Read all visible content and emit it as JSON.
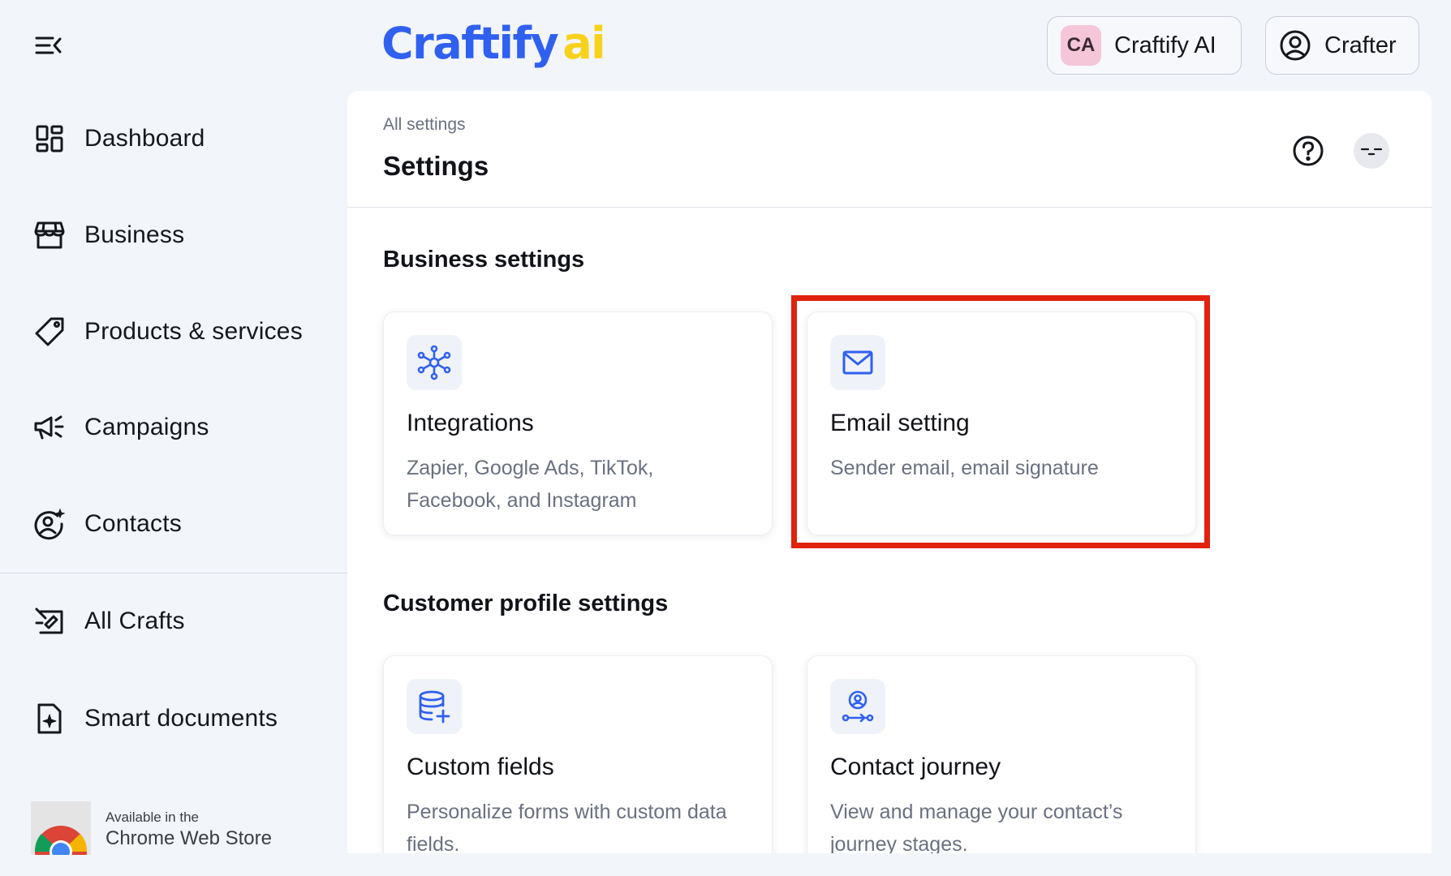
{
  "app": {
    "logo_part1": "Craftify",
    "logo_part2": "ai",
    "brand_color": "#3060f0",
    "brand_accent": "#f8d21a"
  },
  "sidebar": {
    "items": [
      {
        "label": "Dashboard",
        "icon": "dashboard-icon"
      },
      {
        "label": "Business",
        "icon": "store-icon"
      },
      {
        "label": "Products & services",
        "icon": "tag-icon"
      },
      {
        "label": "Campaigns",
        "icon": "megaphone-icon"
      },
      {
        "label": "Contacts",
        "icon": "contact-star-icon"
      },
      {
        "label": "All Crafts",
        "icon": "crafts-icon"
      },
      {
        "label": "Smart documents",
        "icon": "document-sparkle-icon"
      }
    ],
    "chrome_badge": {
      "small": "Available in the",
      "big": "Chrome Web Store"
    }
  },
  "header": {
    "org": {
      "initials": "CA",
      "name": "Craftify AI"
    },
    "user": {
      "label": "Crafter"
    }
  },
  "page": {
    "breadcrumb": "All settings",
    "title": "Settings"
  },
  "sections": {
    "business": {
      "title": "Business settings",
      "cards": [
        {
          "title": "Integrations",
          "desc": "Zapier, Google Ads, TikTok, Facebook, and Instagram",
          "icon": "network-icon"
        },
        {
          "title": "Email setting",
          "desc": "Sender email, email signature",
          "icon": "mail-icon"
        }
      ]
    },
    "customer": {
      "title": "Customer profile settings",
      "cards": [
        {
          "title": "Custom fields",
          "desc": "Personalize forms with custom data fields.",
          "icon": "database-plus-icon"
        },
        {
          "title": "Contact journey",
          "desc": "View and manage your contact’s journey stages.",
          "icon": "user-route-icon"
        }
      ]
    }
  },
  "highlight_color": "#e0220f"
}
